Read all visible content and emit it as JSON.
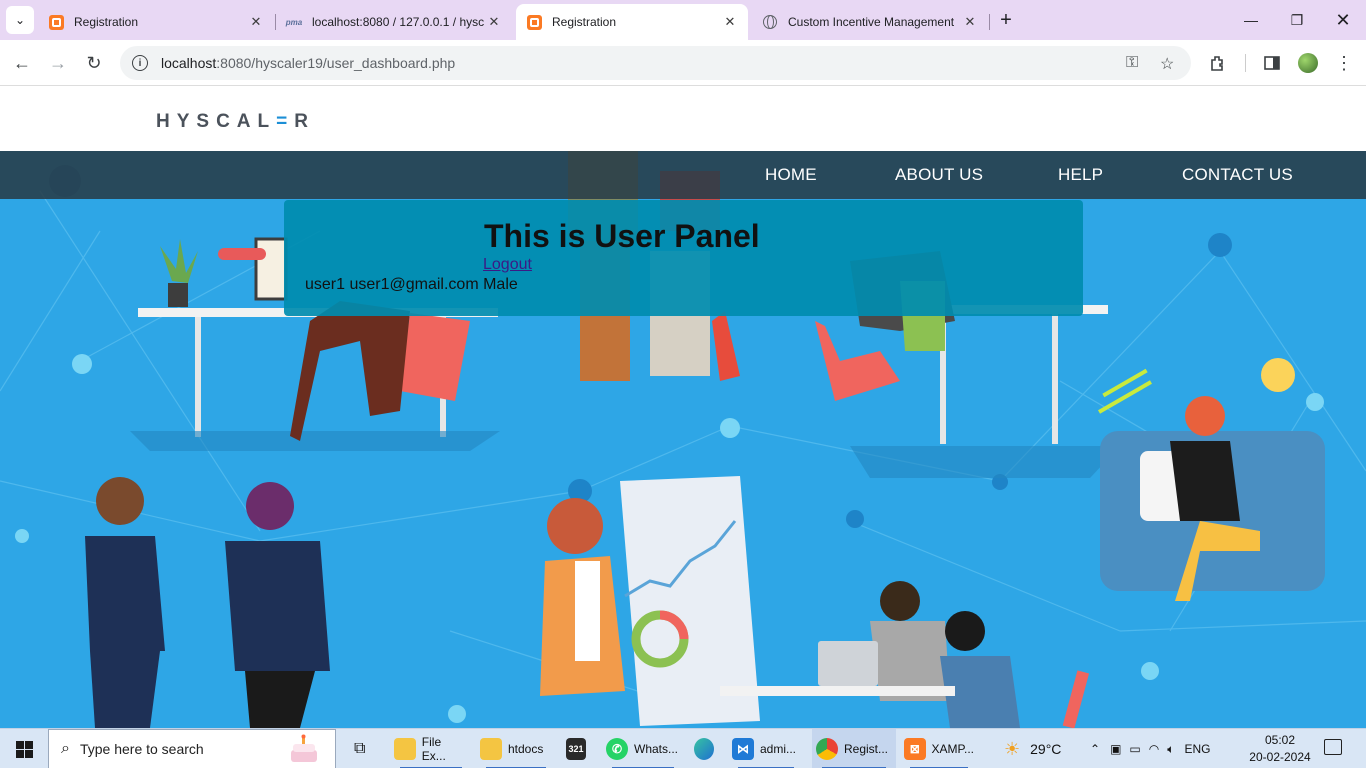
{
  "browser": {
    "tabs": [
      {
        "title": "Registration",
        "icon": "xampp-icon",
        "active": false
      },
      {
        "title": "localhost:8080 / 127.0.0.1 / hysc",
        "icon": "phpmyadmin-icon",
        "active": false
      },
      {
        "title": "Registration",
        "icon": "xampp-icon",
        "active": true
      },
      {
        "title": "Custom Incentive Management",
        "icon": "globe-icon",
        "active": false
      }
    ],
    "url_host": "localhost",
    "url_rest": ":8080/hyscaler19/user_dashboard.php"
  },
  "site": {
    "logo_text": "HYSCAL",
    "logo_accent": "=",
    "logo_end": "R",
    "nav": [
      "HOME",
      "ABOUT US",
      "HELP",
      "CONTACT US"
    ],
    "colors": {
      "hero_bg": "#2ea6e6",
      "navbar_bg": "#283c48",
      "panel_bg": "#008caf",
      "logo_accent": "#1c8fd6"
    }
  },
  "panel": {
    "title": "This is User Panel",
    "logout_label": "Logout",
    "user_line": "user1 user1@gmail.com Male"
  },
  "taskbar": {
    "search_placeholder": "Type here to search",
    "apps": [
      {
        "label": "File Ex...",
        "icon": "file-explorer-icon"
      },
      {
        "label": "htdocs",
        "icon": "folder-icon"
      },
      {
        "label": "",
        "icon": "calendar-app-icon"
      },
      {
        "label": "Whats...",
        "icon": "whatsapp-icon"
      },
      {
        "label": "",
        "icon": "edge-icon"
      },
      {
        "label": "admi...",
        "icon": "vscode-icon"
      },
      {
        "label": "Regist...",
        "icon": "chrome-icon"
      },
      {
        "label": "XAMP...",
        "icon": "xampp-icon"
      }
    ],
    "weather": "29°C",
    "lang": "ENG",
    "time": "05:02",
    "date": "20-02-2024"
  }
}
